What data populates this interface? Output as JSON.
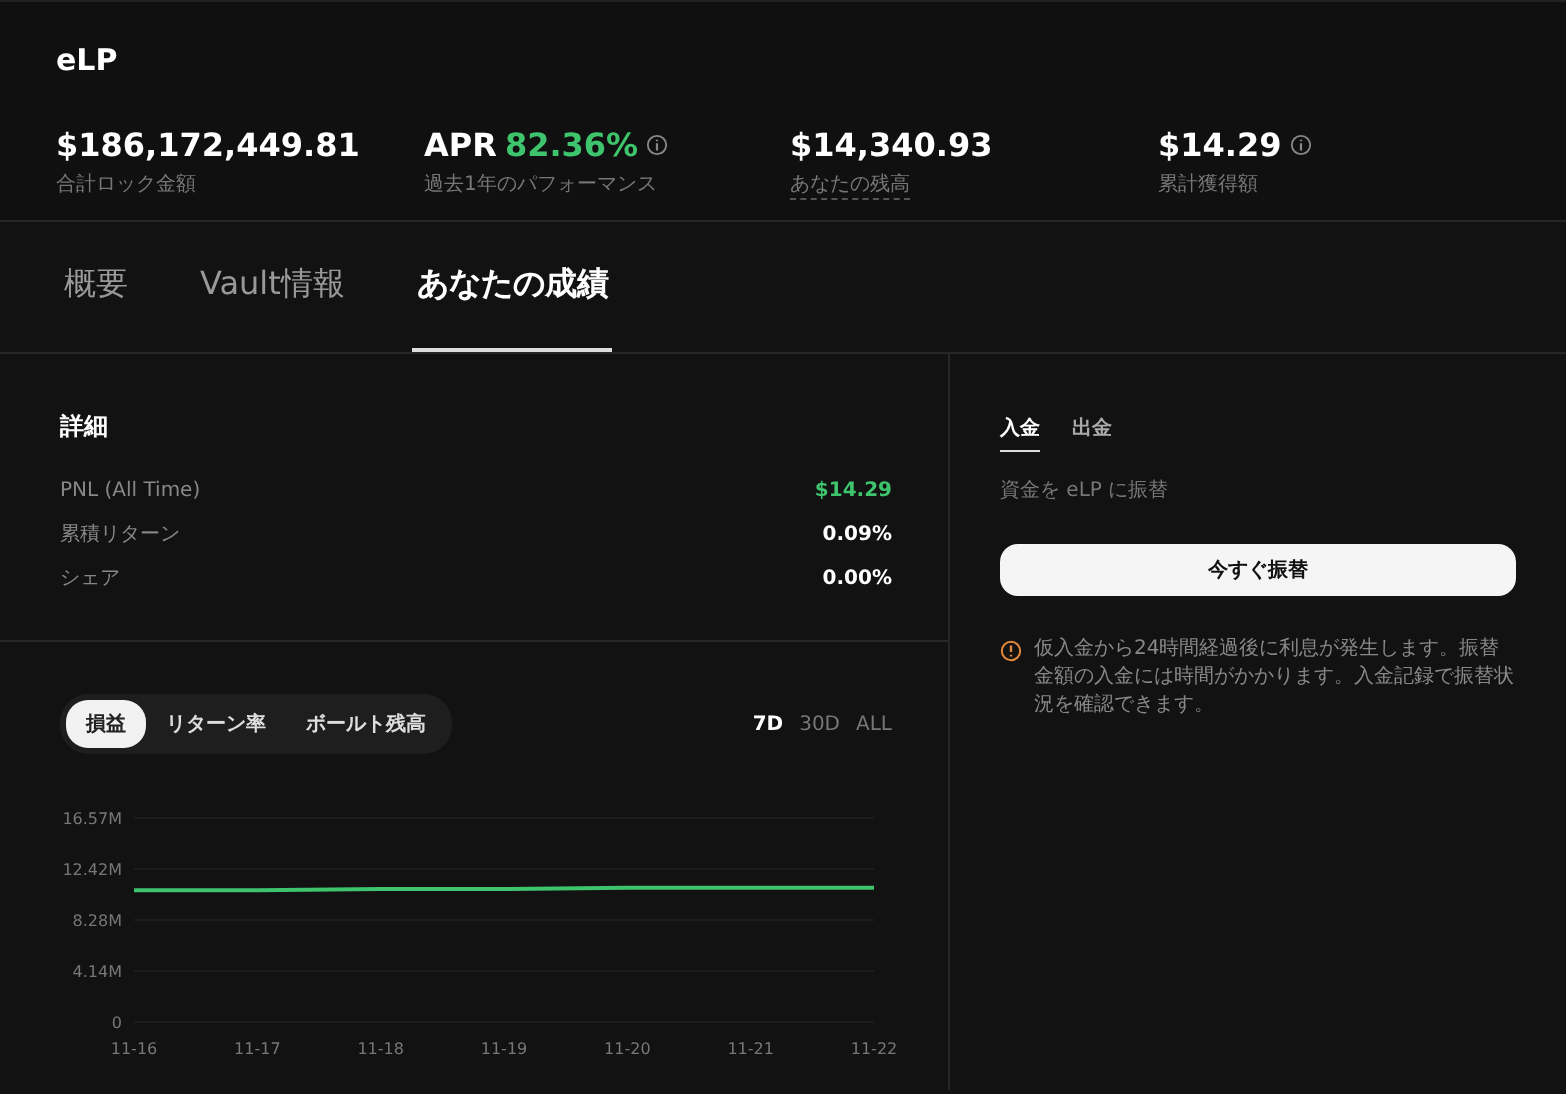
{
  "header": {
    "title": "eLP",
    "stats": [
      {
        "value": "$186,172,449.81",
        "label": "合計ロック金額"
      },
      {
        "prefix": "APR",
        "value": "82.36%",
        "label": "過去1年のパフォーマンス",
        "info": true,
        "highlight": true
      },
      {
        "value": "$14,340.93",
        "label": "あなたの残高",
        "underline": true
      },
      {
        "value": "$14.29",
        "label": "累計獲得額",
        "info": true
      }
    ]
  },
  "tabs": [
    {
      "label": "概要",
      "selected": false
    },
    {
      "label": "Vault情報",
      "selected": false
    },
    {
      "label": "あなたの成績",
      "selected": true
    }
  ],
  "details": {
    "title": "詳細",
    "rows": [
      {
        "label": "PNL (All Time)",
        "value": "$14.29",
        "positive": true
      },
      {
        "label": "累積リターン",
        "value": "0.09%",
        "positive": false
      },
      {
        "label": "シェア",
        "value": "0.00%",
        "positive": false
      }
    ]
  },
  "chart_panel": {
    "metrics": [
      {
        "label": "損益",
        "selected": true
      },
      {
        "label": "リターン率",
        "selected": false
      },
      {
        "label": "ボールト残高",
        "selected": false
      }
    ],
    "ranges": [
      {
        "label": "7D",
        "selected": true
      },
      {
        "label": "30D",
        "selected": false
      },
      {
        "label": "ALL",
        "selected": false
      }
    ],
    "chart_data": {
      "type": "line",
      "categories": [
        "11-16",
        "11-17",
        "11-18",
        "11-19",
        "11-20",
        "11-21",
        "11-22"
      ],
      "series": [
        {
          "color": "#3ec46d",
          "values": [
            10700000,
            10700000,
            10800000,
            10800000,
            10900000,
            10900000,
            10900000
          ]
        }
      ],
      "grid": true,
      "ylim": [
        0,
        16570000
      ],
      "yticks": [
        {
          "value": 0,
          "label": "0"
        },
        {
          "value": 4140000,
          "label": "4.14M"
        },
        {
          "value": 8280000,
          "label": "8.28M"
        },
        {
          "value": 12420000,
          "label": "12.42M"
        },
        {
          "value": 16570000,
          "label": "16.57M"
        }
      ]
    }
  },
  "transfer": {
    "tabs": [
      {
        "label": "入金",
        "selected": true
      },
      {
        "label": "出金",
        "selected": false
      }
    ],
    "description": "資金を eLP に振替",
    "button": "今すぐ振替",
    "notice": "仮入金から24時間経過後に利息が発生します。振替金額の入金には時間がかかります。入金記録で振替状況を確認できます。"
  }
}
